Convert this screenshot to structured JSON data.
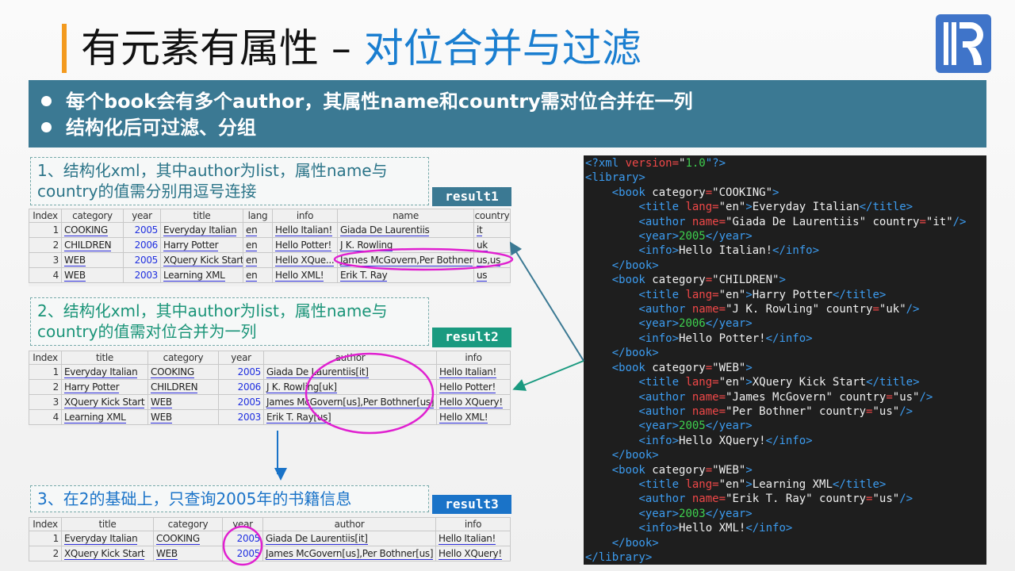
{
  "title": {
    "main": "有元素有属性 – ",
    "highlight": "对位合并与过滤"
  },
  "logo": {
    "text": "R"
  },
  "banner": [
    "每个book会有多个author，其属性name和country需对位合并在一列",
    "结构化后可过滤、分组"
  ],
  "sections": [
    {
      "text": "1、结构化xml，其中author为list，属性name与country的值需分别用逗号连接",
      "badge": "result1"
    },
    {
      "text": "2、结构化xml，其中author为list，属性name与country的值需对位合并为一列",
      "badge": "result2"
    },
    {
      "text": "3、在2的基础上，只查询2005年的书籍信息",
      "badge": "result3"
    }
  ],
  "colors": {
    "accent": "#f39a1e",
    "banner": "#3b7993",
    "result1": "#3b7993",
    "result2": "#1a9a80",
    "result3": "#1a73c8",
    "ellipse": "#e020d0"
  },
  "tables": [
    {
      "columns": [
        "Index",
        "category",
        "year",
        "title",
        "lang",
        "info",
        "name",
        "country"
      ],
      "rows": [
        [
          "1",
          "COOKING",
          "2005",
          "Everyday Italian",
          "en",
          "Hello Italian!",
          "Giada De Laurentiis",
          "it"
        ],
        [
          "2",
          "CHILDREN",
          "2006",
          "Harry Potter",
          "en",
          "Hello Potter!",
          "J K. Rowling",
          "uk"
        ],
        [
          "3",
          "WEB",
          "2005",
          "XQuery Kick Start",
          "en",
          "Hello XQue...",
          "James McGovern,Per Bothner",
          "us,us"
        ],
        [
          "4",
          "WEB",
          "2003",
          "Learning XML",
          "en",
          "Hello XML!",
          "Erik T. Ray",
          "us"
        ]
      ]
    },
    {
      "columns": [
        "Index",
        "title",
        "category",
        "year",
        "author",
        "info"
      ],
      "rows": [
        [
          "1",
          "Everyday Italian",
          "COOKING",
          "2005",
          "Giada De Laurentiis[it]",
          "Hello Italian!"
        ],
        [
          "2",
          "Harry Potter",
          "CHILDREN",
          "2006",
          "J K. Rowling[uk]",
          "Hello Potter!"
        ],
        [
          "3",
          "XQuery Kick Start",
          "WEB",
          "2005",
          "James McGovern[us],Per Bothner[us]",
          "Hello XQuery!"
        ],
        [
          "4",
          "Learning XML",
          "WEB",
          "2003",
          "Erik T. Ray[us]",
          "Hello XML!"
        ]
      ]
    },
    {
      "columns": [
        "Index",
        "title",
        "category",
        "year",
        "author",
        "info"
      ],
      "rows": [
        [
          "1",
          "Everyday Italian",
          "COOKING",
          "2005",
          "Giada De Laurentiis[it]",
          "Hello Italian!"
        ],
        [
          "2",
          "XQuery Kick Start",
          "WEB",
          "2005",
          "James McGovern[us],Per Bothner[us]",
          "Hello XQuery!"
        ]
      ]
    }
  ],
  "code": [
    [
      [
        "<?xml ",
        "t"
      ],
      [
        "version=",
        "a"
      ],
      [
        "\"",
        "s"
      ],
      [
        "1.0",
        "g"
      ],
      [
        "\"?>",
        "t"
      ]
    ],
    [
      [
        "<library>",
        "t"
      ]
    ],
    [
      [
        "    ",
        "s"
      ],
      [
        "<book ",
        "t"
      ],
      [
        "category",
        "s"
      ],
      [
        "=",
        "a"
      ],
      [
        "\"COOKING\"",
        "s"
      ],
      [
        ">",
        "t"
      ]
    ],
    [
      [
        "        ",
        "s"
      ],
      [
        "<title ",
        "t"
      ],
      [
        "lang=",
        "a"
      ],
      [
        "\"en\"",
        "s"
      ],
      [
        ">",
        "t"
      ],
      [
        "Everyday Italian",
        "s"
      ],
      [
        "</title>",
        "t"
      ]
    ],
    [
      [
        "        ",
        "s"
      ],
      [
        "<author ",
        "t"
      ],
      [
        "name=",
        "a"
      ],
      [
        "\"Giada De Laurentiis\" country",
        "s"
      ],
      [
        "=",
        "a"
      ],
      [
        "\"it\"",
        "s"
      ],
      [
        "/>",
        "t"
      ]
    ],
    [
      [
        "        ",
        "s"
      ],
      [
        "<year>",
        "t"
      ],
      [
        "2005",
        "g"
      ],
      [
        "</year>",
        "t"
      ]
    ],
    [
      [
        "        ",
        "s"
      ],
      [
        "<info>",
        "t"
      ],
      [
        "Hello Italian!",
        "s"
      ],
      [
        "</info>",
        "t"
      ]
    ],
    [
      [
        "    ",
        "s"
      ],
      [
        "</book>",
        "t"
      ]
    ],
    [
      [
        "    ",
        "s"
      ],
      [
        "<book ",
        "t"
      ],
      [
        "category",
        "s"
      ],
      [
        "=",
        "a"
      ],
      [
        "\"CHILDREN\"",
        "s"
      ],
      [
        ">",
        "t"
      ]
    ],
    [
      [
        "        ",
        "s"
      ],
      [
        "<title ",
        "t"
      ],
      [
        "lang=",
        "a"
      ],
      [
        "\"en\"",
        "s"
      ],
      [
        ">",
        "t"
      ],
      [
        "Harry Potter",
        "s"
      ],
      [
        "</title>",
        "t"
      ]
    ],
    [
      [
        "        ",
        "s"
      ],
      [
        "<author ",
        "t"
      ],
      [
        "name=",
        "a"
      ],
      [
        "\"J K. Rowling\" country",
        "s"
      ],
      [
        "=",
        "a"
      ],
      [
        "\"uk\"",
        "s"
      ],
      [
        "/>",
        "t"
      ]
    ],
    [
      [
        "        ",
        "s"
      ],
      [
        "<year>",
        "t"
      ],
      [
        "2006",
        "g"
      ],
      [
        "</year>",
        "t"
      ]
    ],
    [
      [
        "        ",
        "s"
      ],
      [
        "<info>",
        "t"
      ],
      [
        "Hello Potter!",
        "s"
      ],
      [
        "</info>",
        "t"
      ]
    ],
    [
      [
        "    ",
        "s"
      ],
      [
        "</book>",
        "t"
      ]
    ],
    [
      [
        "    ",
        "s"
      ],
      [
        "<book ",
        "t"
      ],
      [
        "category",
        "s"
      ],
      [
        "=",
        "a"
      ],
      [
        "\"WEB\"",
        "s"
      ],
      [
        ">",
        "t"
      ]
    ],
    [
      [
        "        ",
        "s"
      ],
      [
        "<title ",
        "t"
      ],
      [
        "lang=",
        "a"
      ],
      [
        "\"en\"",
        "s"
      ],
      [
        ">",
        "t"
      ],
      [
        "XQuery Kick Start",
        "s"
      ],
      [
        "</title>",
        "t"
      ]
    ],
    [
      [
        "        ",
        "s"
      ],
      [
        "<author ",
        "t"
      ],
      [
        "name=",
        "a"
      ],
      [
        "\"James McGovern\" country",
        "s"
      ],
      [
        "=",
        "a"
      ],
      [
        "\"us\"",
        "s"
      ],
      [
        "/>",
        "t"
      ]
    ],
    [
      [
        "        ",
        "s"
      ],
      [
        "<author ",
        "t"
      ],
      [
        "name=",
        "a"
      ],
      [
        "\"Per Bothner\" country",
        "s"
      ],
      [
        "=",
        "a"
      ],
      [
        "\"us\"",
        "s"
      ],
      [
        "/>",
        "t"
      ]
    ],
    [
      [
        "        ",
        "s"
      ],
      [
        "<year>",
        "t"
      ],
      [
        "2005",
        "g"
      ],
      [
        "</year>",
        "t"
      ]
    ],
    [
      [
        "        ",
        "s"
      ],
      [
        "<info>",
        "t"
      ],
      [
        "Hello XQuery!",
        "s"
      ],
      [
        "</info>",
        "t"
      ]
    ],
    [
      [
        "    ",
        "s"
      ],
      [
        "</book>",
        "t"
      ]
    ],
    [
      [
        "    ",
        "s"
      ],
      [
        "<book ",
        "t"
      ],
      [
        "category",
        "s"
      ],
      [
        "=",
        "a"
      ],
      [
        "\"WEB\"",
        "s"
      ],
      [
        ">",
        "t"
      ]
    ],
    [
      [
        "        ",
        "s"
      ],
      [
        "<title ",
        "t"
      ],
      [
        "lang=",
        "a"
      ],
      [
        "\"en\"",
        "s"
      ],
      [
        ">",
        "t"
      ],
      [
        "Learning XML",
        "s"
      ],
      [
        "</title>",
        "t"
      ]
    ],
    [
      [
        "        ",
        "s"
      ],
      [
        "<author ",
        "t"
      ],
      [
        "name=",
        "a"
      ],
      [
        "\"Erik T. Ray\" country",
        "s"
      ],
      [
        "=",
        "a"
      ],
      [
        "\"us\"",
        "s"
      ],
      [
        "/>",
        "t"
      ]
    ],
    [
      [
        "        ",
        "s"
      ],
      [
        "<year>",
        "t"
      ],
      [
        "2003",
        "g"
      ],
      [
        "</year>",
        "t"
      ]
    ],
    [
      [
        "        ",
        "s"
      ],
      [
        "<info>",
        "t"
      ],
      [
        "Hello XML!",
        "s"
      ],
      [
        "</info>",
        "t"
      ]
    ],
    [
      [
        "    ",
        "s"
      ],
      [
        "</book>",
        "t"
      ]
    ],
    [
      [
        "</library>",
        "t"
      ]
    ]
  ]
}
